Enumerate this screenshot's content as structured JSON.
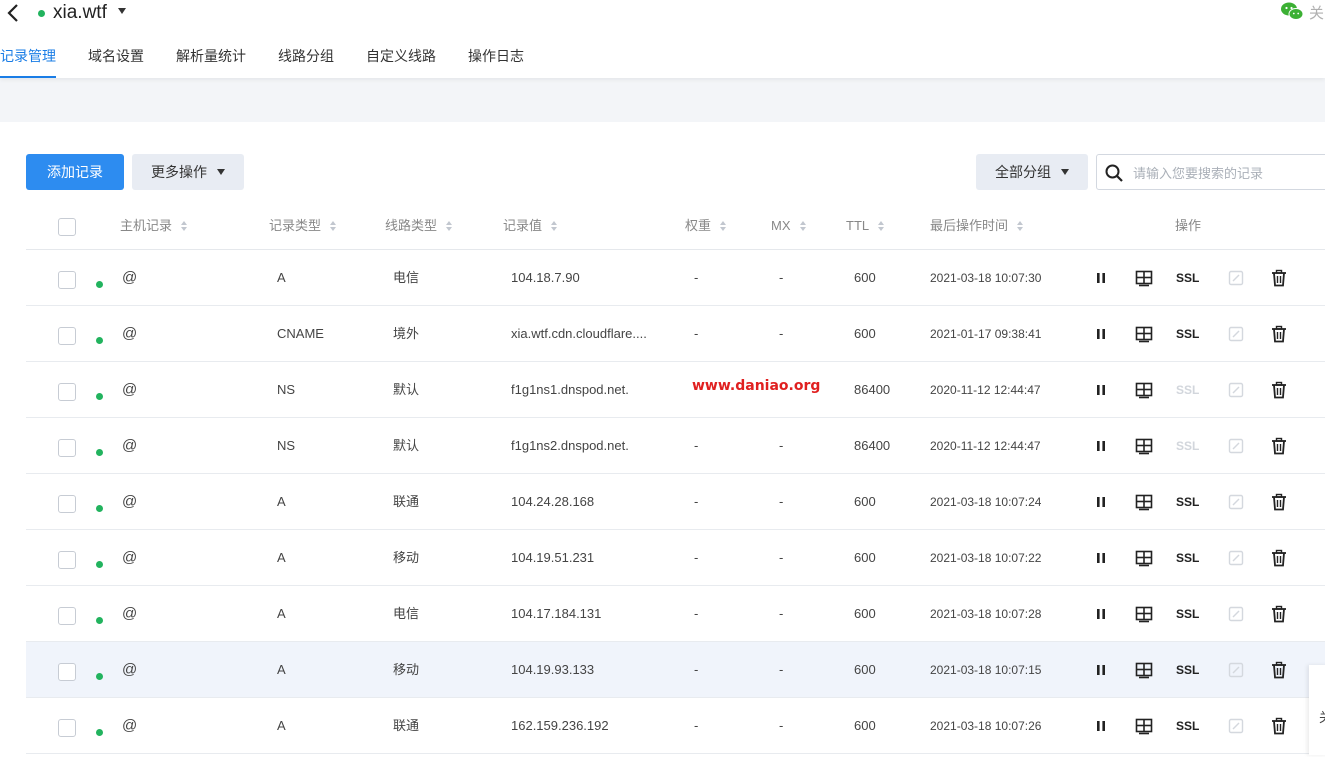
{
  "header": {
    "domain": "xia.wtf",
    "close_label": "关"
  },
  "tabs": [
    {
      "label": "记录管理",
      "active": true
    },
    {
      "label": "域名设置",
      "active": false
    },
    {
      "label": "解析量统计",
      "active": false
    },
    {
      "label": "线路分组",
      "active": false
    },
    {
      "label": "自定义线路",
      "active": false
    },
    {
      "label": "操作日志",
      "active": false
    }
  ],
  "toolbar": {
    "add_label": "添加记录",
    "more_label": "更多操作",
    "group_label": "全部分组",
    "search_placeholder": "请输入您要搜索的记录"
  },
  "columns": {
    "host": "主机记录",
    "type": "记录类型",
    "line": "线路类型",
    "value": "记录值",
    "weight": "权重",
    "mx": "MX",
    "ttl": "TTL",
    "time": "最后操作时间",
    "actions": "操作"
  },
  "rows": [
    {
      "host": "@",
      "type": "A",
      "line": "电信",
      "value": "104.18.7.90",
      "weight": "-",
      "mx": "-",
      "ttl": "600",
      "time": "2021-03-18 10:07:30",
      "ssl": "SSL",
      "ssl_enabled": true
    },
    {
      "host": "@",
      "type": "CNAME",
      "line": "境外",
      "value": "xia.wtf.cdn.cloudflare....",
      "weight": "-",
      "mx": "-",
      "ttl": "600",
      "time": "2021-01-17 09:38:41",
      "ssl": "SSL",
      "ssl_enabled": true
    },
    {
      "host": "@",
      "type": "NS",
      "line": "默认",
      "value": "f1g1ns1.dnspod.net.",
      "weight": "",
      "mx": "",
      "ttl": "86400",
      "time": "2020-11-12 12:44:47",
      "ssl": "SSL",
      "ssl_enabled": false
    },
    {
      "host": "@",
      "type": "NS",
      "line": "默认",
      "value": "f1g1ns2.dnspod.net.",
      "weight": "-",
      "mx": "-",
      "ttl": "86400",
      "time": "2020-11-12 12:44:47",
      "ssl": "SSL",
      "ssl_enabled": false
    },
    {
      "host": "@",
      "type": "A",
      "line": "联通",
      "value": "104.24.28.168",
      "weight": "-",
      "mx": "-",
      "ttl": "600",
      "time": "2021-03-18 10:07:24",
      "ssl": "SSL",
      "ssl_enabled": true
    },
    {
      "host": "@",
      "type": "A",
      "line": "移动",
      "value": "104.19.51.231",
      "weight": "-",
      "mx": "-",
      "ttl": "600",
      "time": "2021-03-18 10:07:22",
      "ssl": "SSL",
      "ssl_enabled": true
    },
    {
      "host": "@",
      "type": "A",
      "line": "电信",
      "value": "104.17.184.131",
      "weight": "-",
      "mx": "-",
      "ttl": "600",
      "time": "2021-03-18 10:07:28",
      "ssl": "SSL",
      "ssl_enabled": true
    },
    {
      "host": "@",
      "type": "A",
      "line": "移动",
      "value": "104.19.93.133",
      "weight": "-",
      "mx": "-",
      "ttl": "600",
      "time": "2021-03-18 10:07:15",
      "ssl": "SSL",
      "ssl_enabled": true
    },
    {
      "host": "@",
      "type": "A",
      "line": "联通",
      "value": "162.159.236.192",
      "weight": "-",
      "mx": "-",
      "ttl": "600",
      "time": "2021-03-18 10:07:26",
      "ssl": "SSL",
      "ssl_enabled": true
    }
  ],
  "watermark": "www.daniao.org",
  "side_float_label": "关",
  "colors": {
    "accent": "#1a7de6",
    "primary_button": "#2d8cf0",
    "status_green": "#22b35e",
    "watermark_red": "#e02020"
  },
  "icons": {
    "back": "chevron-left-icon",
    "wechat": "wechat-icon",
    "search": "search-icon",
    "pause": "pause-icon",
    "load_balance": "load-balance-icon",
    "edit": "edit-icon",
    "delete": "trash-icon"
  }
}
